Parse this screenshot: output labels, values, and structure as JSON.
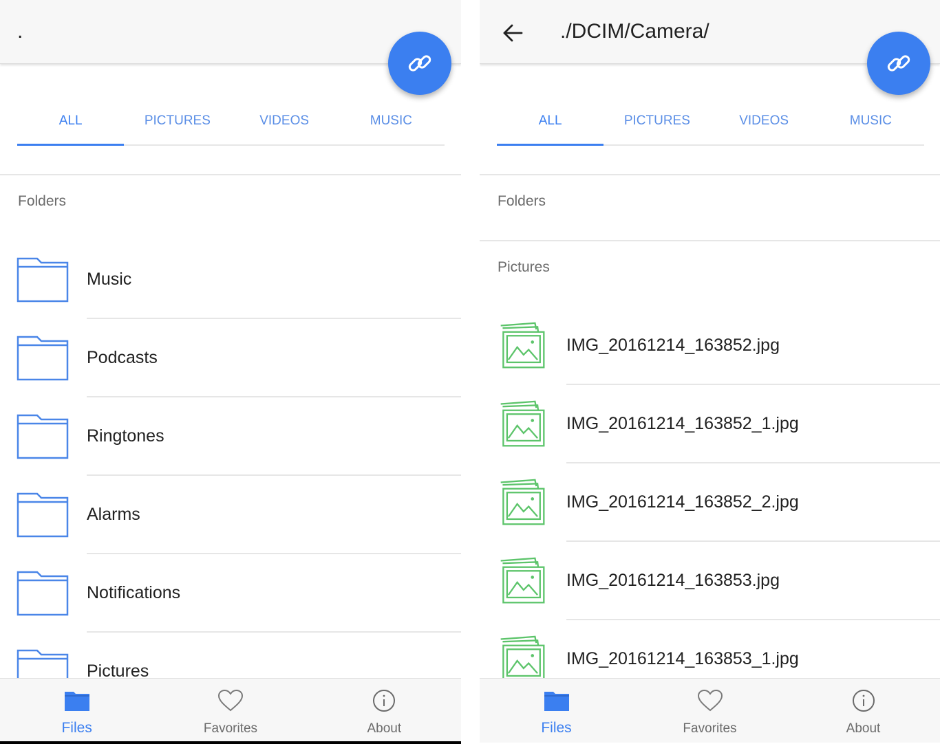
{
  "colors": {
    "accent": "#3b7ff0",
    "folder_icon": "#4a86e8",
    "picture_icon": "#5cc46a",
    "muted_text": "#6b6b6b"
  },
  "left": {
    "appbar": {
      "title": "."
    },
    "tabs": [
      {
        "label": "ALL",
        "active": true
      },
      {
        "label": "PICTURES",
        "active": false
      },
      {
        "label": "VIDEOS",
        "active": false
      },
      {
        "label": "MUSIC",
        "active": false
      }
    ],
    "sections": {
      "folders": "Folders"
    },
    "folders": [
      {
        "name": "Music",
        "icon": "folder-icon"
      },
      {
        "name": "Podcasts",
        "icon": "folder-icon"
      },
      {
        "name": "Ringtones",
        "icon": "folder-icon"
      },
      {
        "name": "Alarms",
        "icon": "folder-icon"
      },
      {
        "name": "Notifications",
        "icon": "folder-icon"
      },
      {
        "name": "Pictures",
        "icon": "folder-icon"
      }
    ],
    "bottom_nav": [
      {
        "label": "Files",
        "icon": "folder-filled-icon",
        "active": true
      },
      {
        "label": "Favorites",
        "icon": "heart-icon",
        "active": false
      },
      {
        "label": "About",
        "icon": "info-icon",
        "active": false
      }
    ]
  },
  "right": {
    "appbar": {
      "title": "./DCIM/Camera/",
      "back_icon": "arrow-back-icon"
    },
    "tabs": [
      {
        "label": "ALL",
        "active": true
      },
      {
        "label": "PICTURES",
        "active": false
      },
      {
        "label": "VIDEOS",
        "active": false
      },
      {
        "label": "MUSIC",
        "active": false
      }
    ],
    "sections": {
      "folders": "Folders",
      "pictures": "Pictures"
    },
    "pictures": [
      {
        "name": "IMG_20161214_163852.jpg",
        "icon": "image-stack-icon"
      },
      {
        "name": "IMG_20161214_163852_1.jpg",
        "icon": "image-stack-icon"
      },
      {
        "name": "IMG_20161214_163852_2.jpg",
        "icon": "image-stack-icon"
      },
      {
        "name": "IMG_20161214_163853.jpg",
        "icon": "image-stack-icon"
      },
      {
        "name": "IMG_20161214_163853_1.jpg",
        "icon": "image-stack-icon"
      }
    ],
    "bottom_nav": [
      {
        "label": "Files",
        "icon": "folder-filled-icon",
        "active": true
      },
      {
        "label": "Favorites",
        "icon": "heart-icon",
        "active": false
      },
      {
        "label": "About",
        "icon": "info-icon",
        "active": false
      }
    ]
  },
  "fab": {
    "icon": "link-icon"
  }
}
